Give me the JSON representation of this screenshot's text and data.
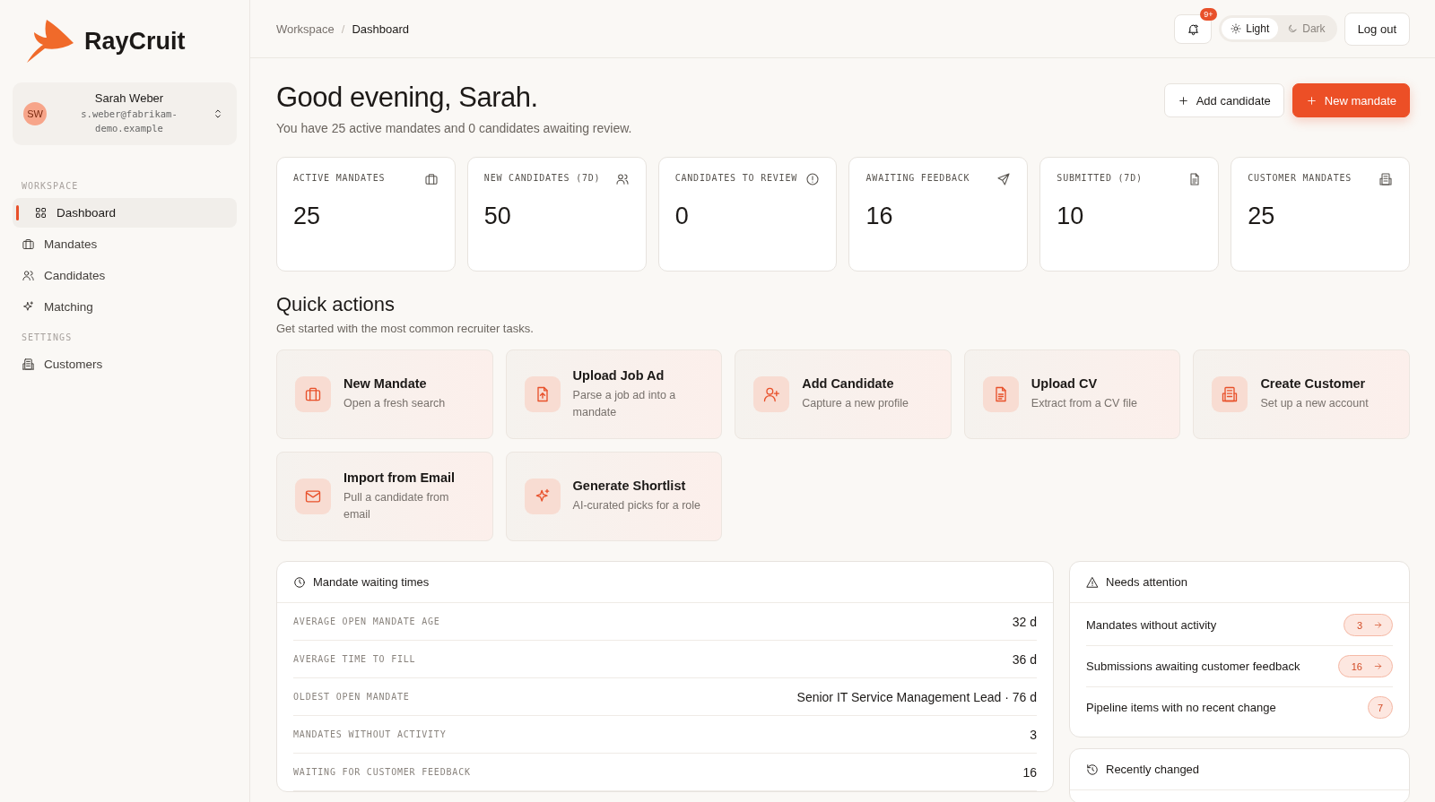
{
  "sidebar": {
    "brand": "RayCruit",
    "user": {
      "initials": "SW",
      "name": "Sarah Weber",
      "email": "s.weber@fabrikam-demo.example"
    },
    "sections": [
      {
        "title": "WORKSPACE",
        "items": [
          {
            "label": "Dashboard",
            "selected": true
          },
          {
            "label": "Mandates",
            "selected": false
          },
          {
            "label": "Candidates",
            "selected": false
          },
          {
            "label": "Matching",
            "selected": false
          }
        ]
      },
      {
        "title": "SETTINGS",
        "items": [
          {
            "label": "Customers",
            "selected": false
          }
        ]
      }
    ]
  },
  "topbar": {
    "breadcrumb": [
      "Workspace",
      "Dashboard"
    ],
    "breadcrumb_separator": "/",
    "notification_badge": "9+",
    "theme": [
      {
        "label": "Light",
        "selected": true
      },
      {
        "label": "Dark",
        "selected": false
      }
    ],
    "logout": "Log out"
  },
  "greeting": {
    "title": "Good evening, Sarah.",
    "subtitle": "You have 25 active mandates and 0 candidates awaiting review."
  },
  "actions": [
    {
      "label": "Add candidate",
      "primary": false
    },
    {
      "label": "New mandate",
      "primary": true
    }
  ],
  "stats": [
    {
      "label": "ACTIVE MANDATES",
      "value": "25"
    },
    {
      "label": "NEW CANDIDATES (7D)",
      "value": "50"
    },
    {
      "label": "CANDIDATES TO REVIEW",
      "value": "0"
    },
    {
      "label": "AWAITING FEEDBACK",
      "value": "16"
    },
    {
      "label": "SUBMITTED (7D)",
      "value": "10"
    },
    {
      "label": "CUSTOMER MANDATES",
      "value": "25"
    }
  ],
  "quick_actions": {
    "title": "Quick actions",
    "subtitle": "Get started with the most common recruiter tasks.",
    "items": [
      {
        "title": "New Mandate",
        "description": "Open a fresh search"
      },
      {
        "title": "Upload Job Ad",
        "description": "Parse a job ad into a mandate"
      },
      {
        "title": "Add Candidate",
        "description": "Capture a new profile"
      },
      {
        "title": "Upload CV",
        "description": "Extract from a CV file"
      },
      {
        "title": "Create Customer",
        "description": "Set up a new account"
      },
      {
        "title": "Import from Email",
        "description": "Pull a candidate from email"
      },
      {
        "title": "Generate Shortlist",
        "description": "AI-curated picks for a role"
      }
    ]
  },
  "waiting_times": {
    "title": "Mandate waiting times",
    "rows": [
      {
        "label": "AVERAGE OPEN MANDATE AGE",
        "value": "32 d"
      },
      {
        "label": "AVERAGE TIME TO FILL",
        "value": "36 d"
      },
      {
        "label": "OLDEST OPEN MANDATE",
        "value": "Senior IT Service Management Lead · 76 d"
      },
      {
        "label": "MANDATES WITHOUT ACTIVITY",
        "value": "3"
      },
      {
        "label": "WAITING FOR CUSTOMER FEEDBACK",
        "value": "16"
      }
    ]
  },
  "needs_attention": {
    "title": "Needs attention",
    "items": [
      {
        "label": "Mandates without activity",
        "count": "3",
        "arrow": true
      },
      {
        "label": "Submissions awaiting customer feedback",
        "count": "16",
        "arrow": true
      },
      {
        "label": "Pipeline items with no recent change",
        "count": "7",
        "arrow": false
      }
    ]
  },
  "recently_changed": {
    "title": "Recently changed"
  }
}
